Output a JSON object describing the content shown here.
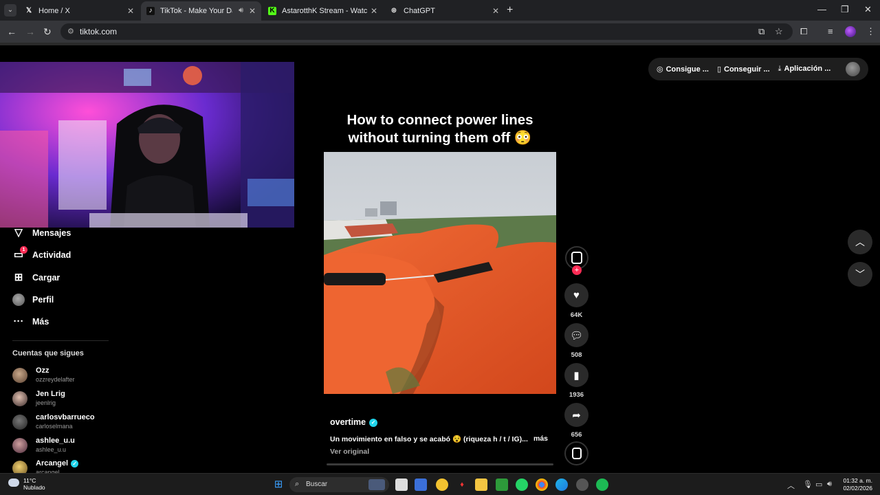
{
  "browser": {
    "tabs": [
      {
        "title": "Home / X",
        "favicon": "x-logo-icon",
        "active": false
      },
      {
        "title": "TikTok - Make Your Day",
        "favicon": "tiktok-logo-icon",
        "active": true,
        "audio": true
      },
      {
        "title": "AstarotthK Stream - Watch Live on Kick",
        "favicon": "kick-logo-icon",
        "active": false
      },
      {
        "title": "ChatGPT",
        "favicon": "chatgpt-logo-icon",
        "active": false
      }
    ],
    "url": "tiktok.com"
  },
  "topbar": {
    "pills": [
      {
        "label": "Consigue ...",
        "icon": "coin-icon"
      },
      {
        "label": "Conseguir ...",
        "icon": "phone-icon"
      },
      {
        "label": "Aplicación ...",
        "icon": "download-icon"
      }
    ]
  },
  "sidebar": {
    "nav": [
      {
        "label": "Mensajes",
        "icon": "send-icon"
      },
      {
        "label": "Actividad",
        "icon": "inbox-icon",
        "badge": "1"
      },
      {
        "label": "Cargar",
        "icon": "upload-plus-icon"
      },
      {
        "label": "Perfil",
        "icon": "profile-avatar"
      },
      {
        "label": "Más",
        "icon": "more-icon"
      }
    ],
    "following_title": "Cuentas que sigues",
    "following": [
      {
        "name": "Ozz",
        "handle": "ozzreydelafter",
        "verified": false
      },
      {
        "name": "Jen Lrig",
        "handle": "jeenlrig",
        "verified": false
      },
      {
        "name": "carlosvbarrueco",
        "handle": "carloselmana",
        "verified": false
      },
      {
        "name": "ashlee_u.u",
        "handle": "ashlee_u.u",
        "verified": false
      },
      {
        "name": "Arcangel",
        "handle": "arcangel",
        "verified": true
      }
    ]
  },
  "video": {
    "overlay_caption": "How to connect power lines without turning them off 😳",
    "author": "overtime",
    "description": "Un movimiento en falso y se acabó 😵 (riqueza h / t / IG)...",
    "more_label": "más",
    "original_label": "Ver original",
    "progress": 0.0
  },
  "actions": {
    "likes": "64K",
    "comments": "508",
    "saves": "1936",
    "shares": "656"
  },
  "taskbar": {
    "weather_temp": "11°C",
    "weather_desc": "Nublado",
    "search_placeholder": "Buscar",
    "time": "01:32 a. m.",
    "date": "02/02/2026"
  }
}
